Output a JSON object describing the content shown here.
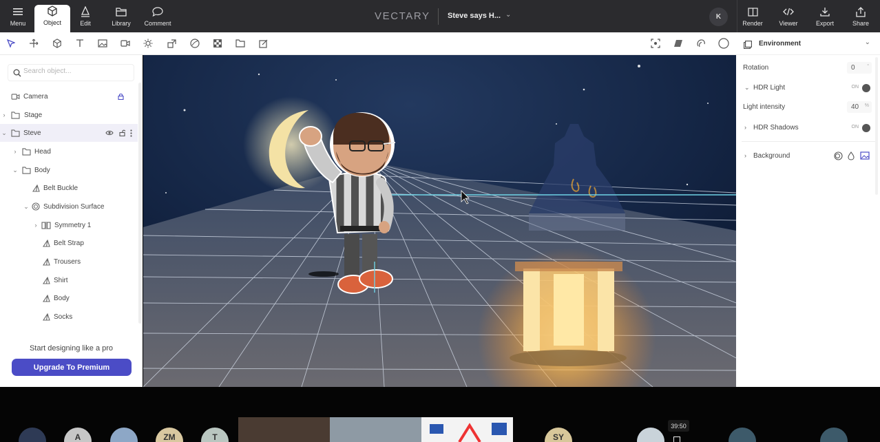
{
  "topbar": {
    "menu_label": "Menu",
    "object_label": "Object",
    "edit_label": "Edit",
    "library_label": "Library",
    "comment_label": "Comment",
    "brand": "VECTARY",
    "doc_title": "Steve says H...",
    "avatar_initial": "K",
    "render_label": "Render",
    "viewer_label": "Viewer",
    "export_label": "Export",
    "share_label": "Share"
  },
  "search": {
    "placeholder": "Search object..."
  },
  "tree": [
    {
      "label": "Camera"
    },
    {
      "label": "Stage"
    },
    {
      "label": "Steve"
    },
    {
      "label": "Head"
    },
    {
      "label": "Body"
    },
    {
      "label": "Belt Buckle"
    },
    {
      "label": "Subdivision Surface"
    },
    {
      "label": "Symmetry 1"
    },
    {
      "label": "Belt Strap"
    },
    {
      "label": "Trousers"
    },
    {
      "label": "Shirt"
    },
    {
      "label": "Body"
    },
    {
      "label": "Socks"
    }
  ],
  "promo": {
    "text": "Start designing like a pro",
    "button": "Upgrade To Premium"
  },
  "right_panel": {
    "title": "Environment",
    "rotation_label": "Rotation",
    "rotation_value": "0",
    "rotation_unit": "°",
    "hdr_light_label": "HDR Light",
    "hdr_light_toggle": "ON",
    "light_intensity_label": "Light intensity",
    "light_intensity_value": "40",
    "light_intensity_unit": "%",
    "hdr_shadows_label": "HDR Shadows",
    "hdr_shadows_toggle": "ON",
    "background_label": "Background"
  },
  "bottom_bar": {
    "timer": "39:50",
    "participants": [
      "A",
      "ZM",
      "T",
      "SY"
    ]
  },
  "colors": {
    "accent": "#4b4cc6",
    "topbar": "#2b2b2e",
    "selection_line": "#6fd3e6"
  }
}
